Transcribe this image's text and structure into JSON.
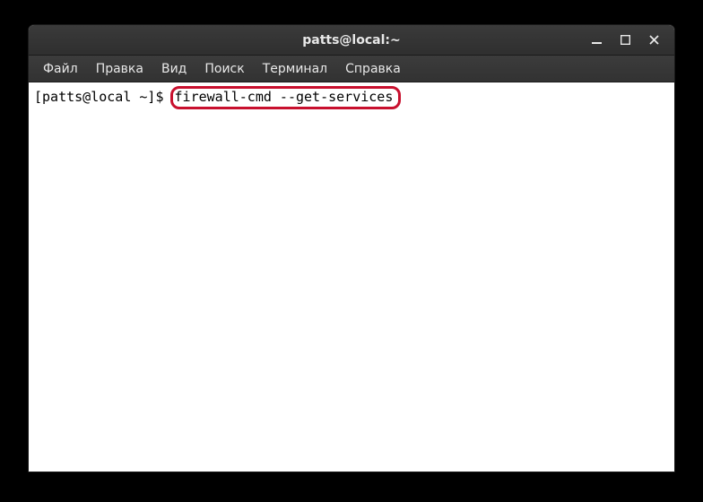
{
  "window": {
    "title": "patts@local:~"
  },
  "menu": {
    "file": "Файл",
    "edit": "Правка",
    "view": "Вид",
    "search": "Поиск",
    "terminal": "Терминал",
    "help": "Справка"
  },
  "terminal": {
    "prompt": "[patts@local ~]$ ",
    "command": "firewall-cmd --get-services"
  },
  "colors": {
    "highlight_border": "#c8102e",
    "titlebar_bg": "#333333",
    "menubar_bg": "#363636",
    "terminal_bg": "#ffffff",
    "text_light": "#e8e8e8",
    "text_dark": "#000000"
  }
}
